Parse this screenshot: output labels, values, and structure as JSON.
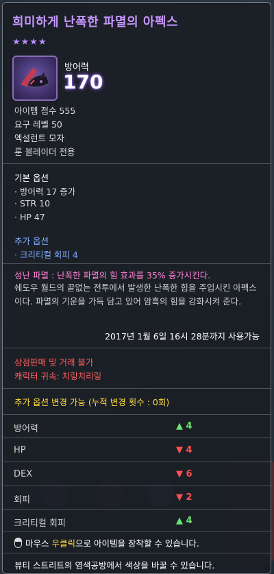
{
  "item": {
    "name": "희미하게 난폭한 파멸의 아펙스",
    "stars": "★★★★",
    "main_stat_label": "방어력",
    "main_stat_value": "170",
    "icon": "dark-helmet-icon"
  },
  "info": {
    "score": "아이템 점수 555",
    "req_level": "요구 레벨 50",
    "grade": "엑설런트 모자",
    "class": "룬 블레이더 전용"
  },
  "base_options": {
    "header": "기본 옵션",
    "lines": [
      "· 방어력 17 증가",
      "· STR 10",
      "· HP 47"
    ]
  },
  "extra_options": {
    "header": "추가 옵션",
    "lines": [
      "· 크리티컬 회피 4"
    ]
  },
  "set_effect": "성난 파멸 : 난폭한 파멸의 힘 효과를 35% 증가시킨다.",
  "description": "쉐도우 월드의 끝없는 전투에서 발생한 난폭한 힘을 주입시킨 아펙스이다. 파멸의 기운을 가득 담고 있어 암흑의 힘을 강화시켜 준다.",
  "expiry": "2017년 1월 6일 16시 28분까지 사용가능",
  "restrictions": {
    "trade": "상점판매 및 거래 불가",
    "bound": "캐릭터 귀속: 치링치리링"
  },
  "option_change": {
    "header": "추가 옵션 변경 가능 (누적 변경 횟수 : 0회)",
    "rows": [
      {
        "name": "방어력",
        "delta": "▲ 4",
        "dir": "up"
      },
      {
        "name": "HP",
        "delta": "▼ 4",
        "dir": "down"
      },
      {
        "name": "DEX",
        "delta": "▼ 6",
        "dir": "down"
      },
      {
        "name": "회피",
        "delta": "▼ 2",
        "dir": "down"
      },
      {
        "name": "크리티컬 회피",
        "delta": "▲ 4",
        "dir": "up"
      }
    ]
  },
  "footer": {
    "equip_pre": "마우스 ",
    "equip_key": "우클릭",
    "equip_post": "으로 아이템을 장착할 수 있습니다.",
    "dye": "뷰티 스트리트의 염색공방에서 색상을 바꿀 수 있습니다."
  },
  "colors": {
    "title": "#c596ff",
    "extra_option": "#7ea8ff",
    "set_effect": "#ff80d6",
    "restriction": "#ff5b5b",
    "option_change": "#ffd83c",
    "up": "#6de36d",
    "down": "#ff5151"
  }
}
